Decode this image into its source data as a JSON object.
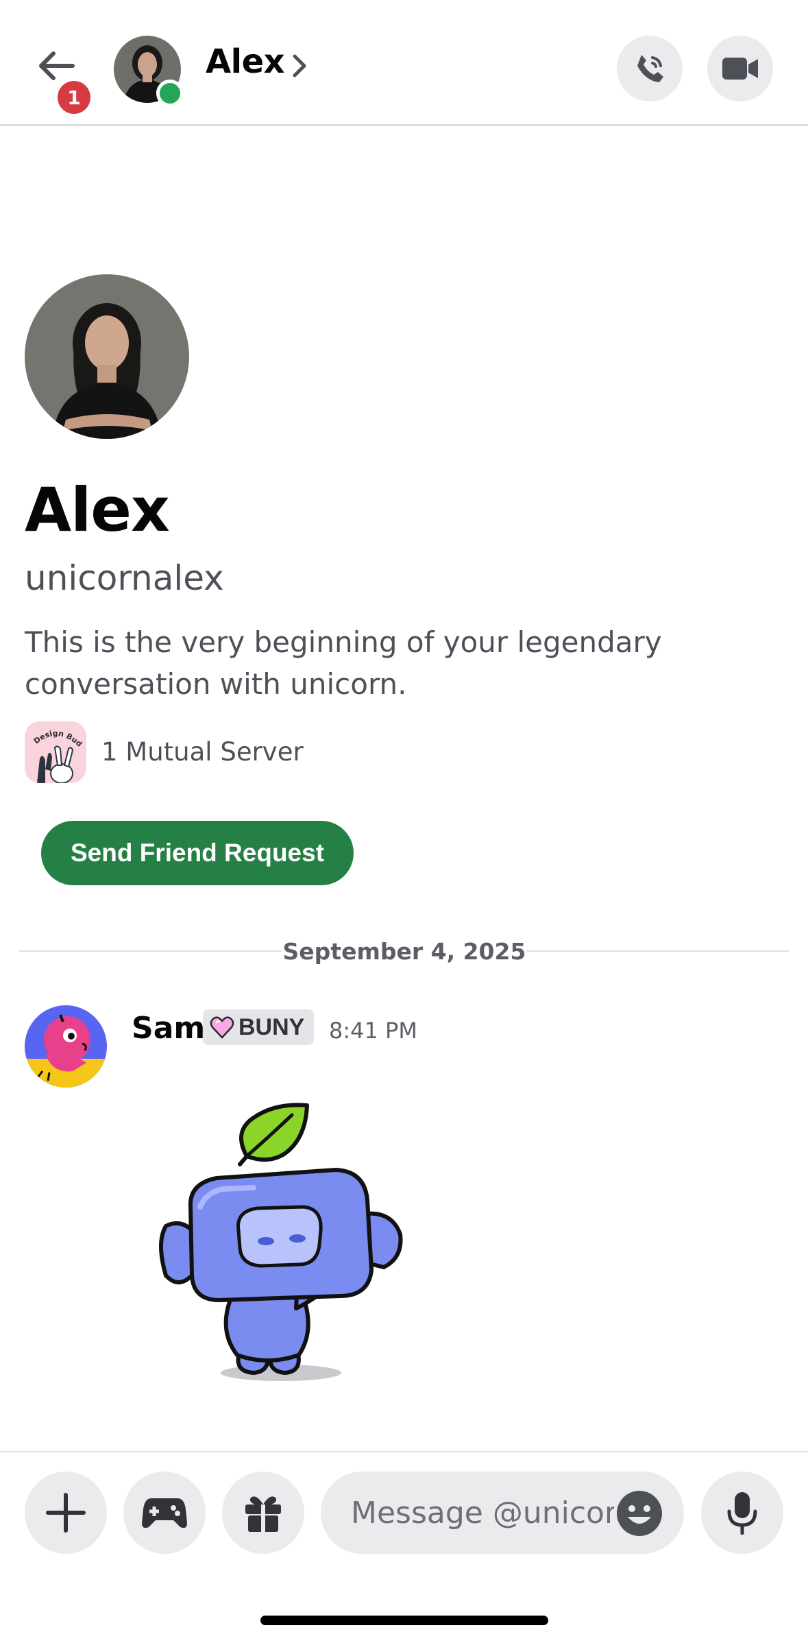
{
  "header": {
    "back_badge": "1",
    "name": "Alex"
  },
  "profile": {
    "display_name": "Alex",
    "username": "unicornalex",
    "intro": "This is the very beginning of your legendary conversation with unicorn.",
    "mutual_servers": "1 Mutual Server",
    "mutual_server_icon_text": "Design Buddies",
    "friend_button": "Send Friend Request"
  },
  "divider": {
    "date": "September 4, 2025"
  },
  "message": {
    "author": "Sam",
    "tag": "BUNY",
    "time": "8:41 PM",
    "sticker": "wumpus-leaf-sticker"
  },
  "composer": {
    "placeholder": "Message @unicornalex"
  },
  "colors": {
    "brand_green": "#248045",
    "online": "#23a55a",
    "badge_red": "#d83a42",
    "button_bg": "#ebebed",
    "wumpus_blue": "#7a8cf0"
  }
}
